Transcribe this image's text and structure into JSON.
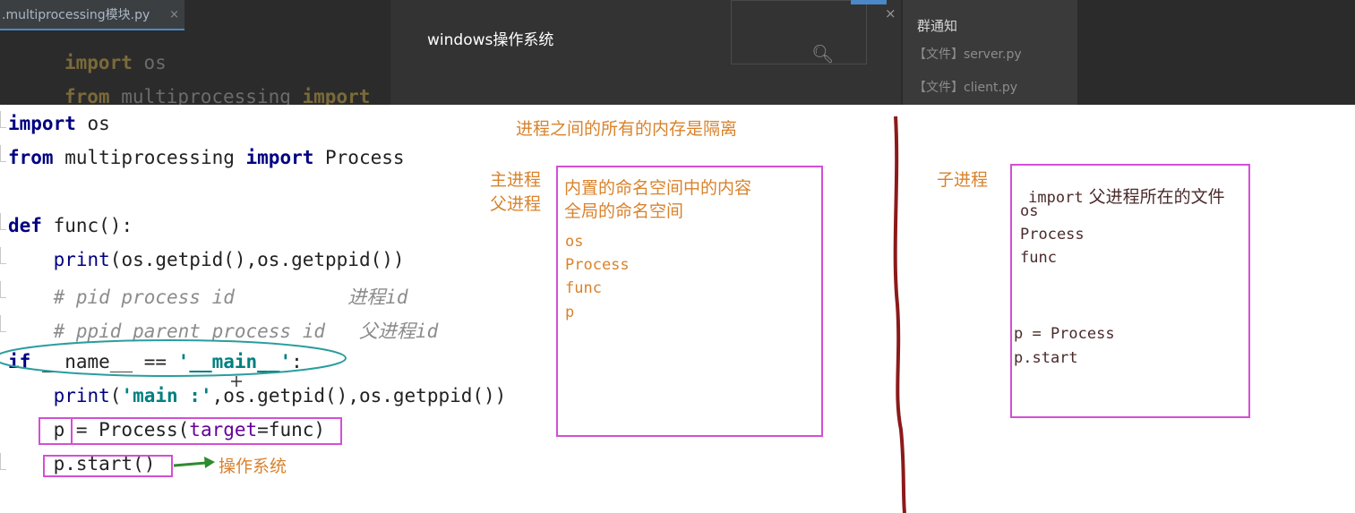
{
  "ide": {
    "tab_label": ".multiprocessing模块.py",
    "tab_close": "×",
    "ghost_line1_kw": "import",
    "ghost_line1_rest": " os",
    "ghost_line2_kw": "from",
    "ghost_line2_rest": " multiprocessing ",
    "ghost_line2_kw2": "import"
  },
  "popup": {
    "title": "windows操作系统",
    "close": "×"
  },
  "group_panel": {
    "title": "群通知",
    "files": [
      "【文件】server.py",
      "【文件】client.py"
    ]
  },
  "code": {
    "l1_kw": "import",
    "l1_rest": " os",
    "l2_kw": "from",
    "l2_mid": " multiprocessing ",
    "l2_kw2": "import",
    "l2_rest": " Process",
    "l3_kw": "def",
    "l3_rest": " func():",
    "l4_a": "    ",
    "l4_bi": "print",
    "l4_rest": "(os.getpid(),os.getppid())",
    "l5": "    # pid process id          进程id",
    "l6": "    # ppid parent process id   父进程id",
    "l7_kw": "if",
    "l7_mid": " __name__ == ",
    "l7_str": "'__main__'",
    "l7_end": ":",
    "l8_a": "    ",
    "l8_bi": "print",
    "l8_p": "(",
    "l8_str": "'main :'",
    "l8_rest": ",os.getpid(),os.getppid())",
    "l9_a": "    p = Process(",
    "l9_param": "target",
    "l9_rest": "=func)",
    "l10": "    p.start()"
  },
  "annotations": {
    "os_label": "操作系统",
    "isolation_note": "进程之间的所有的内存是隔离",
    "main_process": "主进程",
    "parent_process": "父进程",
    "child_process": "子进程"
  },
  "parent_box": {
    "line1": "内置的命名空间中的内容",
    "line2": "全局的命名空间",
    "names": [
      "os",
      "Process",
      "func",
      "p"
    ]
  },
  "child_box": {
    "header_code": "import",
    "header_text": " 父进程所在的文件",
    "names": [
      "os",
      "Process",
      "func"
    ],
    "extra": [
      "p = Process",
      "p.start"
    ]
  },
  "colors": {
    "annotation_orange": "#d9822b",
    "box_magenta": "#d44fd4",
    "divider_red": "#8b1a1a",
    "ellipse_teal": "#2a9d9d",
    "arrow_green": "#2e8b2e"
  }
}
